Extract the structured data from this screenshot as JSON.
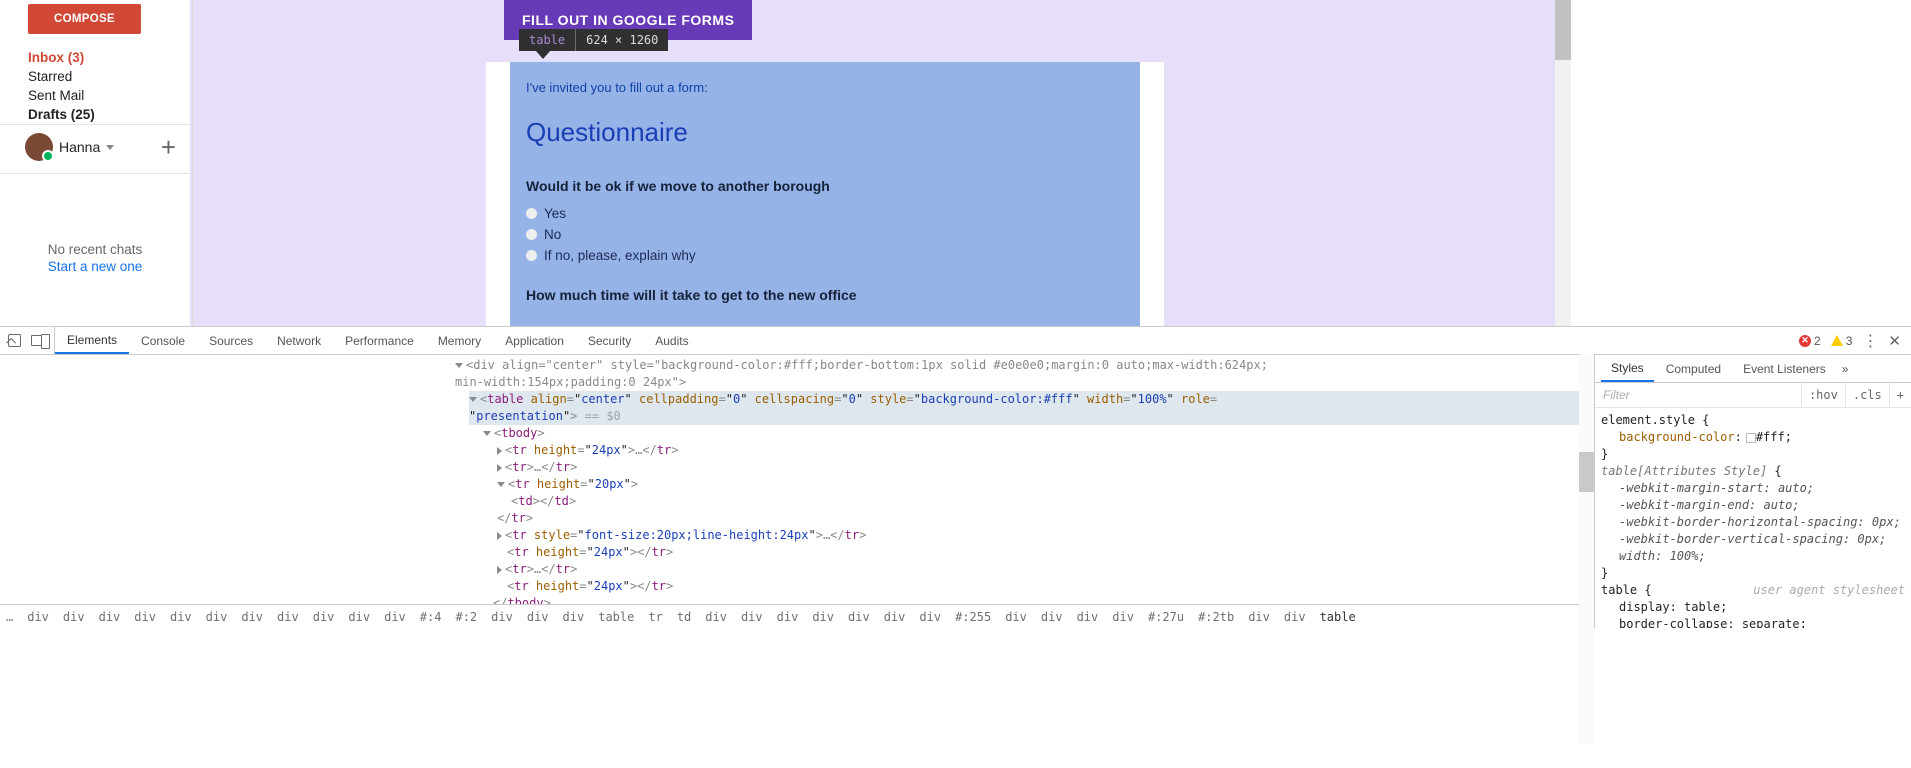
{
  "sidebar": {
    "compose": "COMPOSE",
    "items": [
      "Inbox (3)",
      "Starred",
      "Sent Mail",
      "Drafts (25)"
    ],
    "user_name": "Hanna",
    "nochats": "No recent chats",
    "startnew": "Start a new one"
  },
  "forms_button": "FILL OUT IN GOOGLE FORMS",
  "tooltip": {
    "tag": "table",
    "dims": "624 × 1260"
  },
  "email": {
    "invite": "I've invited you to fill out a form:",
    "title": "Questionnaire",
    "q1": "Would it be ok if we move to another borough",
    "opts": [
      "Yes",
      "No",
      "If no, please, explain why"
    ],
    "q2": "How much time will it take to get to the new office"
  },
  "devtools": {
    "tabs": [
      "Elements",
      "Console",
      "Sources",
      "Network",
      "Performance",
      "Memory",
      "Application",
      "Security",
      "Audits"
    ],
    "errors": "2",
    "warnings": "3",
    "dom": {
      "divline": "<div align=\"center\" style=\"background-color:#fff;border-bottom:1px solid #e0e0e0;margin:0 auto;max-width:624px;",
      "divline2": "min-width:154px;padding:0 24px\">",
      "table_open_align": "align",
      "table_open_center": "center",
      "table_open_cp": "cellpadding",
      "table_open_cs": "cellspacing",
      "zero": "0",
      "table_open_style": "style",
      "table_style_val": "background-color:#fff",
      "table_open_width": "width",
      "widthval": "100%",
      "table_open_role": "role",
      "roleval": "presentation",
      "eqzero": "== $0",
      "tr24_h": "height",
      "tr24_v": "24px",
      "tr20_v": "20px",
      "trstyle": "font-size:20px;line-height:24px"
    },
    "breadcrumb": [
      "…",
      "div",
      "div",
      "div",
      "div",
      "div",
      "div",
      "div",
      "div",
      "div",
      "div",
      "div",
      "#:4",
      "#:2",
      "div",
      "div",
      "div",
      "table",
      "tr",
      "td",
      "div",
      "div",
      "div",
      "div",
      "div",
      "div",
      "div",
      "#:255",
      "div",
      "div",
      "div",
      "div",
      "#:27u",
      "#:2tb",
      "div",
      "div",
      "table"
    ],
    "styles": {
      "tabs": [
        "Styles",
        "Computed",
        "Event Listeners"
      ],
      "filter_ph": "Filter",
      "hov": ":hov",
      "cls": ".cls",
      "rule1_sel": "element.style",
      "rule1_prop": "background-color",
      "rule1_val": "#fff",
      "rule2_sel": "table[Attributes Style]",
      "rule2": [
        [
          "-webkit-margin-start",
          "auto"
        ],
        [
          "-webkit-margin-end",
          "auto"
        ],
        [
          "-webkit-border-horizontal-spacing",
          "0px"
        ],
        [
          "-webkit-border-vertical-spacing",
          "0px"
        ],
        [
          "width",
          "100%"
        ]
      ],
      "rule3_sel": "table",
      "rule3_uas": "user agent stylesheet",
      "rule3": [
        [
          "display",
          "table"
        ],
        [
          "border-collapse",
          "separate"
        ]
      ]
    }
  }
}
